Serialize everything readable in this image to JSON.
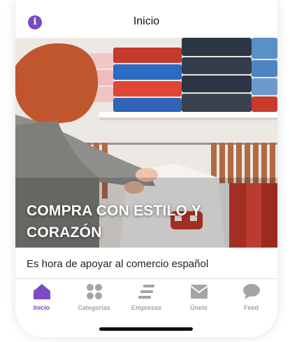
{
  "header": {
    "title": "Inicio",
    "info_icon": "info-icon"
  },
  "hero": {
    "caption": "COMPRA CON ESTILO Y CORAZÓN",
    "image": "woman-browsing-clothing-rack-photo"
  },
  "subtitle": "Es hora de apoyar al comercio español",
  "tabbar": {
    "tabs": [
      {
        "label": "Inicio",
        "icon": "home-icon",
        "active": true
      },
      {
        "label": "Categorías",
        "icon": "grid-icon",
        "active": false
      },
      {
        "label": "Empresas",
        "icon": "list-icon",
        "active": false
      },
      {
        "label": "Únete",
        "icon": "mail-icon",
        "active": false
      },
      {
        "label": "Feed",
        "icon": "chat-icon",
        "active": false
      }
    ]
  },
  "colors": {
    "accent": "#7b4bc4",
    "inactive": "#a4a4a4"
  }
}
